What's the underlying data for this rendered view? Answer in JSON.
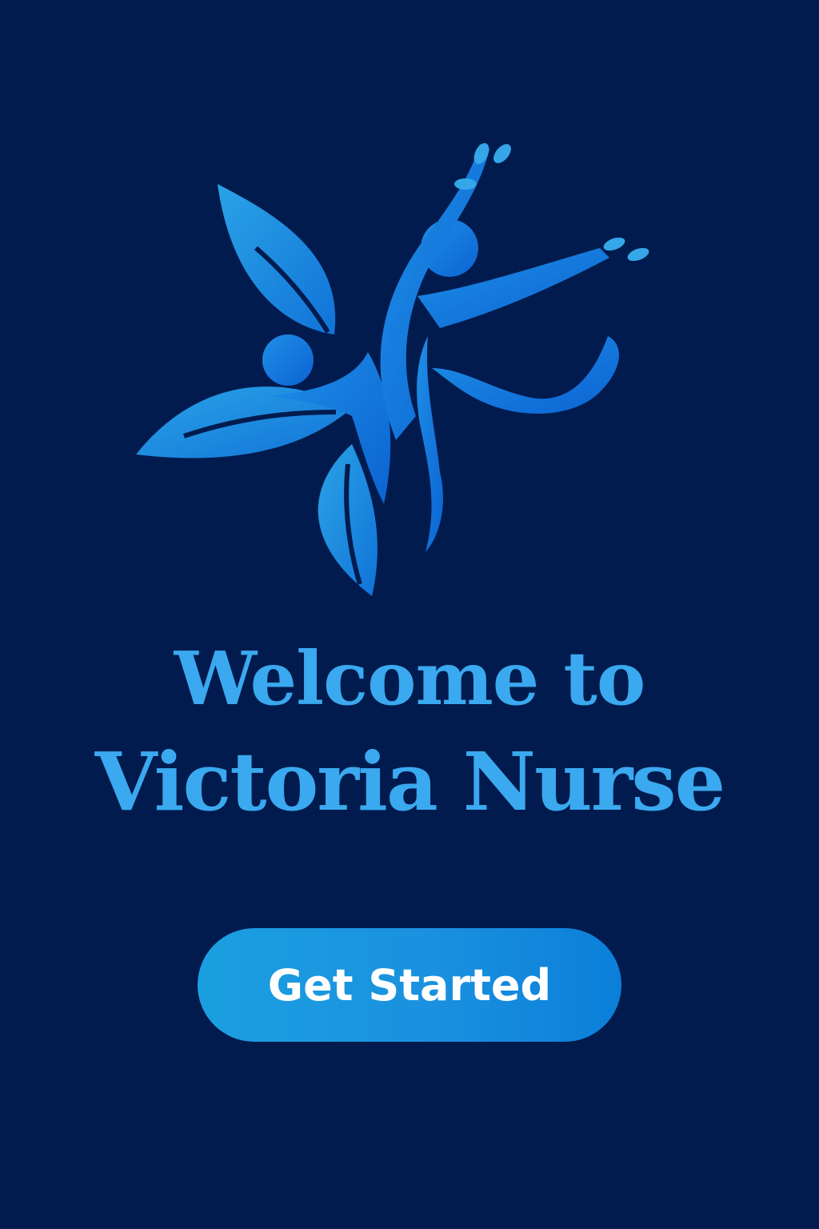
{
  "brand": {
    "logo_icon": "victoria-nurse-logo-icon",
    "colors": {
      "background": "#021b4e",
      "accent": "#3aa9ef",
      "button_start": "#1b9fe0",
      "button_end": "#0b7fd9",
      "button_text": "#ffffff"
    }
  },
  "welcome": {
    "line1": "Welcome to",
    "line2": "Victoria Nurse"
  },
  "cta": {
    "label": "Get Started"
  }
}
